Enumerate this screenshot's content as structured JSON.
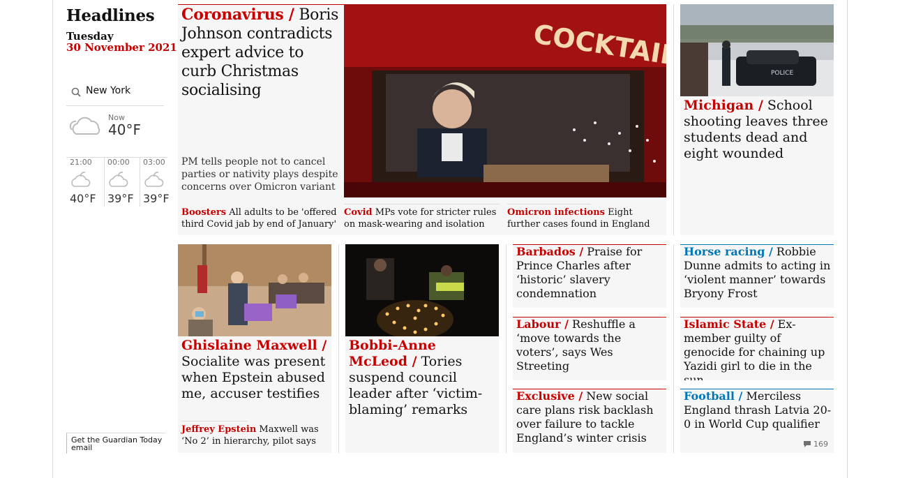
{
  "sidebar": {
    "title": "Headlines",
    "day": "Tuesday",
    "date": "30 November 2021",
    "location": "New York",
    "weather_now_label": "Now",
    "weather_now_temp": "40°F",
    "forecast": [
      {
        "time": "21:00",
        "temp": "40°F"
      },
      {
        "time": "00:00",
        "temp": "39°F"
      },
      {
        "time": "03:00",
        "temp": "39°F"
      }
    ],
    "email_signup": "Get the Guardian Today email"
  },
  "lead": {
    "kicker": "Coronavirus /",
    "headline": "Boris Johnson contradicts expert advice to curb Christmas socialising",
    "standfirst": "PM tells people not to cancel parties or nativity plays despite concerns over Omicron variant",
    "image_sign": "COCKTAILS",
    "sublinks": [
      {
        "kicker": "Boosters",
        "text": "All adults to be 'offered third Covid jab by end of January'"
      },
      {
        "kicker": "Covid",
        "text": "MPs vote for stricter rules on mask-wearing and isolation"
      },
      {
        "kicker": "Omicron infections",
        "text": "Eight further cases found in England"
      }
    ]
  },
  "michigan": {
    "kicker": "Michigan /",
    "headline": "School shooting leaves three students dead and eight wounded",
    "image_text": "POLICE"
  },
  "maxwell": {
    "kicker": "Ghislaine Maxwell /",
    "headline": "Socialite was present when Epstein abused me, accuser testifies",
    "sublink_kicker": "Jeffrey Epstein",
    "sublink_text": "Maxwell was ‘No 2’ in hierarchy, pilot says"
  },
  "mcleod": {
    "kicker": "Bobbi-Anne McLeod /",
    "headline": "Tories suspend council leader after ‘victim-blaming’ remarks"
  },
  "small_cards": [
    {
      "kicker": "Barbados /",
      "text": "Praise for Prince Charles after ‘historic’ slavery condemnation"
    },
    {
      "kicker": "Labour /",
      "text": "Reshuffle a ‘move towards the voters’, says Wes Streeting"
    },
    {
      "kicker": "Exclusive /",
      "text": "New social care plans risk backlash over failure to tackle England’s winter crisis"
    },
    {
      "kicker": "Horse racing /",
      "text": "Robbie Dunne admits to acting in ‘violent manner’ towards Bryony Frost"
    },
    {
      "kicker": "Islamic State /",
      "text": "Ex-member guilty of genocide for chaining up Yazidi girl to die in the sun"
    },
    {
      "kicker": "Football /",
      "text": "Merciless England thrash Latvia 20-0 in World Cup qualifier"
    }
  ],
  "comment_count": "169",
  "colors": {
    "news": "#c70000",
    "sport": "#0077b6",
    "card_bg": "#f6f6f6"
  }
}
